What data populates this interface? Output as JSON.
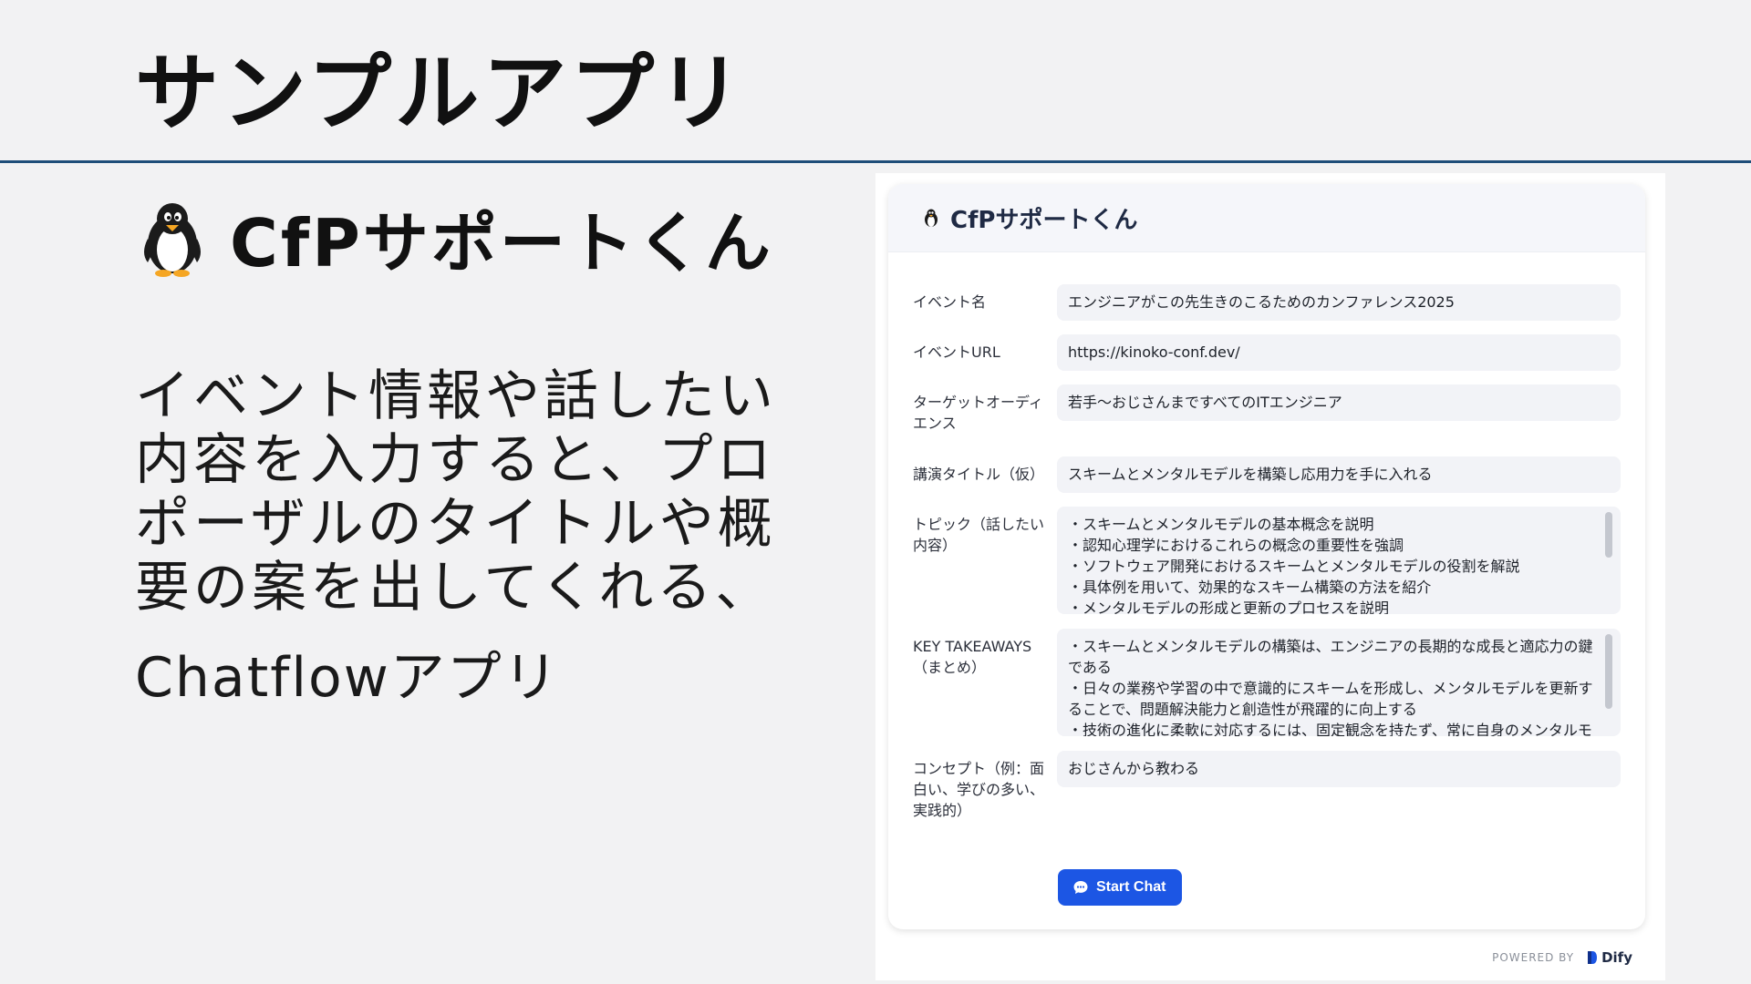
{
  "slide": {
    "title": "サンプルアプリ",
    "app_name": "CfPサポートくん",
    "description": "イベント情報や話したい内容を入力すると、プロポーザルのタイトルや概要の案を出してくれる、",
    "description_line2": "Chatflowアプリ"
  },
  "app": {
    "header_title": "CfPサポートくん",
    "fields": {
      "event_name": {
        "label": "イベント名",
        "value": "エンジニアがこの先生きのこるためのカンファレンス2025"
      },
      "event_url": {
        "label": "イベントURL",
        "value": "https://kinoko-conf.dev/"
      },
      "target_audience": {
        "label": "ターゲットオーディエンス",
        "value": "若手〜おじさんまですべてのITエンジニア"
      },
      "talk_title": {
        "label": "講演タイトル（仮）",
        "value": "スキームとメンタルモデルを構築し応用力を手に入れる"
      },
      "topic": {
        "label": "トピック（話したい内容）",
        "lines": [
          "・スキームとメンタルモデルの基本概念を説明",
          "・認知心理学におけるこれらの概念の重要性を強調",
          "・ソフトウェア開発におけるスキームとメンタルモデルの役割を解説",
          "・具体例を用いて、効果的なスキーム構築の方法を紹介",
          "・メンタルモデルの形成と更新のプロセスを説明"
        ]
      },
      "key_takeaways": {
        "label": "KEY TAKEAWAYS（まとめ）",
        "lines": [
          "・スキームとメンタルモデルの構築は、エンジニアの長期的な成長と適応力の鍵である",
          "・日々の業務や学習の中で意識的にスキームを形成し、メンタルモデルを更新することで、問題解決能力と創造性が飛躍的に向上する",
          "・技術の進化に柔軟に対応するには、固定観念を持たず、常に自身のメンタルモ"
        ]
      },
      "concept": {
        "label": "コンセプト（例：面白い、学びの多い、実践的）",
        "value": "おじさんから教わる"
      }
    },
    "start_button_label": "Start Chat",
    "powered_by": "POWERED BY",
    "brand": "Dify"
  },
  "colors": {
    "rule": "#1f4e79",
    "primary_button": "#1c56e4",
    "field_bg": "#f2f3f7"
  },
  "icons": {
    "app_icon": "penguin-icon",
    "button_icon": "chat-bubble-icon",
    "brand_icon": "dify-logo-icon"
  }
}
